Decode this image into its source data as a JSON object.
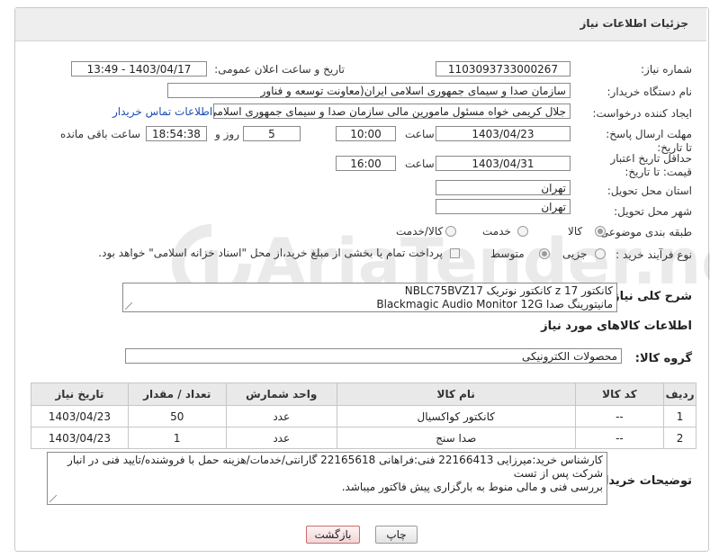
{
  "panel": {
    "title": "جزئیات اطلاعات نیاز"
  },
  "form": {
    "need_number_label": "شماره نیاز:",
    "need_number": "1103093733000267",
    "announce_label": "تاریخ و ساعت اعلان عمومی:",
    "announce_value": "1403/04/17 - 13:49",
    "buyer_org_label": "نام دستگاه خریدار:",
    "buyer_org": "سازمان صدا و سیمای جمهوری اسلامی ایران(معاونت توسعه و فناور",
    "creator_label": "ایجاد کننده درخواست:",
    "creator": "جلال کریمی خواه مسئول مامورین مالی  سازمان صدا و سیمای جمهوری اسلامی ایران",
    "contact_link": "اطلاعات تماس خریدار",
    "reply_deadline_label": "مهلت ارسال پاسخ: تا تاریخ:",
    "reply_date": "1403/04/23",
    "time_label": "ساعت",
    "reply_time": "10:00",
    "days_value": "5",
    "days_label": "روز و",
    "remaining_time": "18:54:38",
    "remaining_label": "ساعت باقی مانده",
    "validity_label": "حداقل تاریخ اعتبار قیمت: تا تاریخ:",
    "validity_date": "1403/04/31",
    "validity_time": "16:00",
    "province_label": "استان محل تحویل:",
    "province": "تهران",
    "city_label": "شهر محل تحویل:",
    "city": "تهران",
    "category_label": "طبقه بندی موضوعی:",
    "category_options": [
      "کالا",
      "خدمت",
      "کالا/خدمت"
    ],
    "process_label": "نوع فرآیند خرید :",
    "process_options": [
      "جزیی",
      "متوسط"
    ],
    "payment_note": "پرداخت تمام یا بخشی از مبلغ خرید،از محل \"اسناد خزانه اسلامی\" خواهد بود."
  },
  "summary": {
    "label": "شرح کلی نیاز:",
    "lines": [
      "کانکتور z 17 کانکتور نوتریک  NBLC75BVZ17",
      "مانیتورینگ صدا Blackmagic Audio Monitor 12G"
    ]
  },
  "goods_info_title": "اطلاعات کالاهای مورد نیاز",
  "goods_group": {
    "label": "گروه کالا:",
    "value": "محصولات الکترونیکی"
  },
  "table": {
    "headers": [
      "ردیف",
      "کد کالا",
      "نام کالا",
      "واحد شمارش",
      "تعداد / مقدار",
      "تاریخ نیاز"
    ],
    "rows": [
      [
        "1",
        "--",
        "کانکتور کواکسیال",
        "عدد",
        "50",
        "1403/04/23"
      ],
      [
        "2",
        "--",
        "صدا سنج",
        "عدد",
        "1",
        "1403/04/23"
      ]
    ]
  },
  "buyer_notes": {
    "label": "توضیحات خریدار:",
    "lines": [
      "کارشناس خرید:میرزایی 22166413  فنی:فراهانی 22165618 گارانتی/خدمات/هزینه حمل با فروشنده/تایید فنی در انبار",
      "شرکت پس از تست",
      "بررسی فنی و مالی منوط به بارگزاری پیش فاکتور میباشد."
    ]
  },
  "buttons": {
    "print": "چاپ",
    "back": "بازگشت"
  },
  "watermark": "AriaTender.neT"
}
